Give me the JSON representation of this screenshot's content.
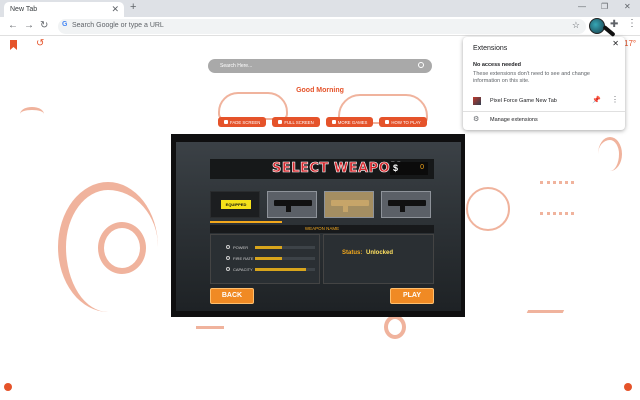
{
  "browser": {
    "tab_title": "New Tab",
    "omnibox_placeholder": "Search Google or type a URL"
  },
  "page": {
    "search_placeholder": "Search Here...",
    "greeting": "Good Morning",
    "temperature": "17°",
    "buttons": [
      "FADE SCREEN",
      "FULL SCREEN",
      "MORE GAMES",
      "HOW TO PLAY"
    ]
  },
  "game": {
    "title": "SELECT WEAPON",
    "coin_symbol": "$",
    "coins": "0",
    "equipped_label": "EQUIPPED",
    "weapon_name_label": "WEAPON NAME",
    "stats": [
      {
        "label": "POWER",
        "fill": 0.45
      },
      {
        "label": "FIRE RATE",
        "fill": 0.45
      },
      {
        "label": "CAPACITY",
        "fill": 0.85
      }
    ],
    "status_label": "Status:",
    "status_value": "Unlocked",
    "back_label": "BACK",
    "play_label": "PLAY"
  },
  "extensions_popup": {
    "title": "Extensions",
    "no_access_heading": "No access needed",
    "no_access_desc": "These extensions don't need to see and change information on this site.",
    "extension_name": "Pixel Force Game New Tab",
    "manage_label": "Manage extensions"
  },
  "colors": {
    "accent": "#e5532a",
    "doodle": "#f0b39d",
    "pin": "#1a73e8"
  }
}
